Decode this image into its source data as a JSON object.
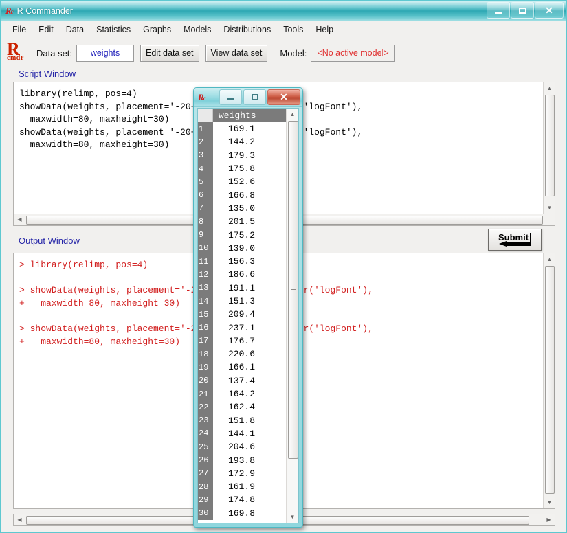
{
  "window": {
    "title": "R Commander",
    "icon": "r-commander-icon",
    "controls": {
      "minimize": "minimize",
      "maximize": "maximize",
      "close": "close"
    }
  },
  "menubar": {
    "items": [
      "File",
      "Edit",
      "Data",
      "Statistics",
      "Graphs",
      "Models",
      "Distributions",
      "Tools",
      "Help"
    ]
  },
  "toolbar": {
    "logo_main": "R",
    "logo_sub": "cmdr",
    "dataset_label": "Data set:",
    "dataset_value": "weights",
    "edit_button": "Edit data set",
    "view_button": "View data set",
    "model_label": "Model:",
    "model_value": "<No active model>"
  },
  "script_window": {
    "label": "Script Window",
    "lines": [
      "library(relimp, pos=4)",
      "showData(weights, placement='-20+200', font=getRcmdr('logFont'),",
      "  maxwidth=80, maxheight=30)",
      "showData(weights, placement='-20+200', font=getRcmdr('logFont'),",
      "  maxwidth=80, maxheight=30)"
    ]
  },
  "output_window": {
    "label": "Output Window",
    "lines": [
      "> library(relimp, pos=4)",
      "",
      "> showData(weights, placement='-20+200', font=getRcmdr('logFont'),",
      "+   maxwidth=80, maxheight=30)",
      "",
      "> showData(weights, placement='-20+200', font=getRcmdr('logFont'),",
      "+   maxwidth=80, maxheight=30)"
    ]
  },
  "submit": {
    "label": "Submit",
    "icon": "left-arrow-icon"
  },
  "data_window": {
    "icon": "r-commander-icon",
    "controls": {
      "minimize": "minimize",
      "maximize": "maximize",
      "close": "close"
    },
    "column_header": "weights",
    "rows": [
      {
        "n": "1",
        "value": "169.1"
      },
      {
        "n": "2",
        "value": "144.2"
      },
      {
        "n": "3",
        "value": "179.3"
      },
      {
        "n": "4",
        "value": "175.8"
      },
      {
        "n": "5",
        "value": "152.6"
      },
      {
        "n": "6",
        "value": "166.8"
      },
      {
        "n": "7",
        "value": "135.0"
      },
      {
        "n": "8",
        "value": "201.5"
      },
      {
        "n": "9",
        "value": "175.2"
      },
      {
        "n": "10",
        "value": "139.0"
      },
      {
        "n": "11",
        "value": "156.3"
      },
      {
        "n": "12",
        "value": "186.6"
      },
      {
        "n": "13",
        "value": "191.1"
      },
      {
        "n": "14",
        "value": "151.3"
      },
      {
        "n": "15",
        "value": "209.4"
      },
      {
        "n": "16",
        "value": "237.1"
      },
      {
        "n": "17",
        "value": "176.7"
      },
      {
        "n": "18",
        "value": "220.6"
      },
      {
        "n": "19",
        "value": "166.1"
      },
      {
        "n": "20",
        "value": "137.4"
      },
      {
        "n": "21",
        "value": "164.2"
      },
      {
        "n": "22",
        "value": "162.4"
      },
      {
        "n": "23",
        "value": "151.8"
      },
      {
        "n": "24",
        "value": "144.1"
      },
      {
        "n": "25",
        "value": "204.6"
      },
      {
        "n": "26",
        "value": "193.8"
      },
      {
        "n": "27",
        "value": "172.9"
      },
      {
        "n": "28",
        "value": "161.9"
      },
      {
        "n": "29",
        "value": "174.8"
      },
      {
        "n": "30",
        "value": "169.8"
      }
    ]
  },
  "colors": {
    "titlebar_accent": "#2fa9b4",
    "label_blue": "#2727a8",
    "output_red": "#d22020",
    "logo_red": "#cc2200",
    "dataset_blue": "#2222bb"
  }
}
